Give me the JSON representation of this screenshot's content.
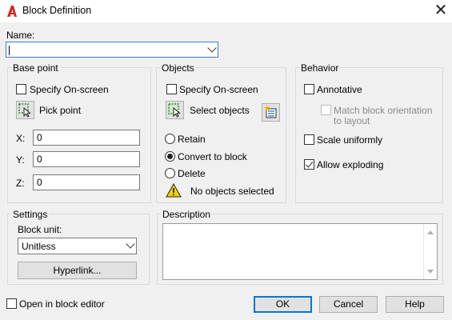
{
  "window": {
    "title": "Block Definition",
    "close_icon": "close-icon",
    "app_icon": "autocad-a-icon",
    "accent": "#d9251d"
  },
  "name": {
    "label": "Name:",
    "value": ""
  },
  "base_point": {
    "title": "Base point",
    "specify_onscreen": "Specify On-screen",
    "pick_point": "Pick point",
    "x_label": "X:",
    "x_value": "0",
    "y_label": "Y:",
    "y_value": "0",
    "z_label": "Z:",
    "z_value": "0"
  },
  "objects": {
    "title": "Objects",
    "specify_onscreen": "Specify On-screen",
    "select_objects": "Select objects",
    "retain": "Retain",
    "convert_to_block": "Convert to block",
    "delete": "Delete",
    "status": "No objects selected",
    "selected_option": "Convert to block"
  },
  "behavior": {
    "title": "Behavior",
    "annotative": "Annotative",
    "match_orientation_line1": "Match block orientation",
    "match_orientation_line2": "to layout",
    "scale_uniformly": "Scale uniformly",
    "allow_exploding": "Allow exploding",
    "allow_exploding_checked": true
  },
  "settings": {
    "title": "Settings",
    "block_unit_label": "Block unit:",
    "block_unit_value": "Unitless",
    "hyperlink": "Hyperlink..."
  },
  "description": {
    "title": "Description",
    "value": ""
  },
  "footer": {
    "open_in_block_editor": "Open in block editor",
    "ok": "OK",
    "cancel": "Cancel",
    "help": "Help"
  }
}
